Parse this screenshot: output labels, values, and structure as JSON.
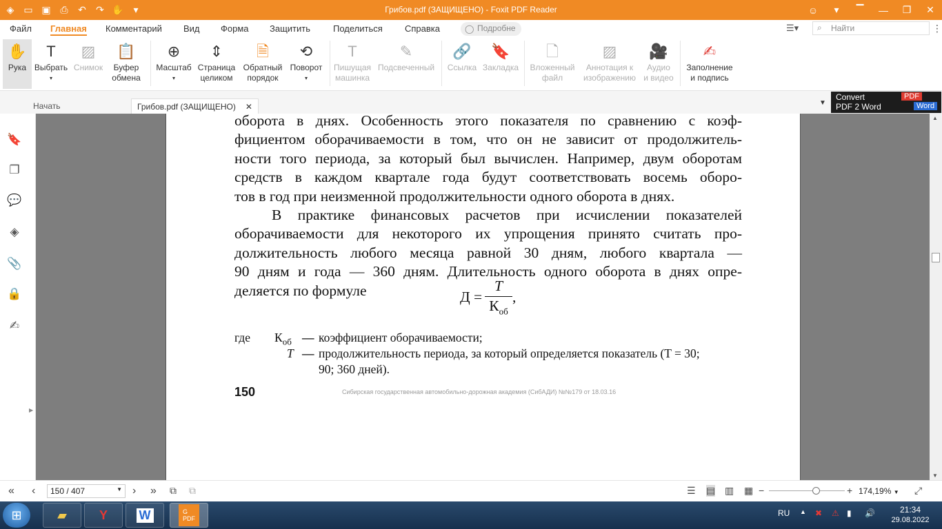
{
  "window": {
    "title": "Грибов.pdf (ЗАЩИЩЕНО) - Foxit PDF Reader"
  },
  "menu": {
    "items": [
      "Файл",
      "Главная",
      "Комментарий",
      "Вид",
      "Форма",
      "Защитить",
      "Поделиться",
      "Справка"
    ],
    "active": "Главная",
    "tell_me": "Подробне",
    "search_placeholder": "Найти"
  },
  "ribbon": {
    "hand": "Рука",
    "select": "Выбрать",
    "snapshot": "Снимок",
    "clipboard_1": "Буфер",
    "clipboard_2": "обмена",
    "zoom": "Масштаб",
    "fitpage_1": "Страница",
    "fitpage_2": "целиком",
    "reverse_1": "Обратный",
    "reverse_2": "порядок",
    "rotate": "Поворот",
    "typewriter_1": "Пишущая",
    "typewriter_2": "машинка",
    "highlight": "Подсвеченный",
    "link": "Ссылка",
    "bookmark": "Закладка",
    "attach_1": "Вложенный",
    "attach_2": "файл",
    "imgannot_1": "Аннотация к",
    "imgannot_2": "изображению",
    "audio_1": "Аудио",
    "audio_2": "и видео",
    "fillsign_1": "Заполнение",
    "fillsign_2": "и подпись"
  },
  "tabs": {
    "start": "Начать",
    "doc": "Грибов.pdf (ЗАЩИЩЕНО)"
  },
  "ad": {
    "line1": "Convert",
    "line2": "PDF 2 Word",
    "pdf": "PDF",
    "word": "Word"
  },
  "document": {
    "p1_lines": [
      "оборота в днях. Особенность этого показателя по сравнению с коэф-",
      "фициентом оборачиваемости в том, что он не зависит от продолжитель-",
      "ности того периода, за который был вычислен. Например, двум оборотам",
      "средств в каждом квартале года будут соответствовать восемь оборо-",
      "тов в год при неизменной продолжительности одного оборота в днях."
    ],
    "p2_lines": [
      "В практике финансовых расчетов при исчислении показателей",
      "оборачиваемости для некоторого их упрощения принято считать про-",
      "должительность любого месяца равной 30 дням, любого квартала —",
      "90 дням и года — 360 дням. Длительность одного оборота в днях опре-",
      "деляется по формуле"
    ],
    "formula": {
      "lhs": "Д =",
      "numerator": "T",
      "denominator": "К",
      "denominator_sub": "об",
      "tail": ","
    },
    "where": "где",
    "legend": [
      {
        "symbol": "К",
        "symbol_sub": "об",
        "dash": "—",
        "text": "коэффициент оборачиваемости;"
      },
      {
        "symbol": "T",
        "symbol_sub": "",
        "dash": "—",
        "text": "продолжительность периода, за который определяется показатель (T = 30;",
        "text2": "90; 360 дней)."
      }
    ],
    "page_number": "150",
    "watermark": "Сибирская государственная автомобильно-дорожная академия (СибАДИ) №№179 от 18.03.16"
  },
  "statusbar": {
    "page_field": "150 / 407",
    "zoom_value": "174,19%"
  },
  "taskbar": {
    "lang": "RU",
    "time": "21:34",
    "date": "29.08.2022",
    "foxit_label": "PDF"
  }
}
